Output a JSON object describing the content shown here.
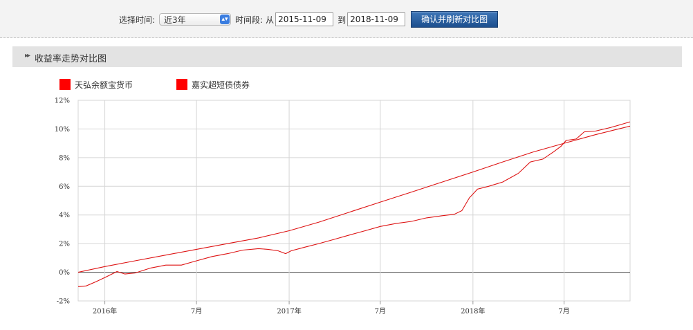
{
  "toolbar": {
    "select_time_label": "选择时间:",
    "period_value": "近3年",
    "range_label": "时间段:",
    "from_label": "从",
    "start_date": "2015-11-09",
    "to_label": "到",
    "end_date": "2018-11-09",
    "confirm_button": "确认并刷新对比图"
  },
  "section": {
    "title": "收益率走势对比图"
  },
  "colors": {
    "series1": "#ff0000",
    "series2": "#e00000",
    "line": "#dd1111",
    "grid": "#d5d5d5",
    "zero_line": "#555555"
  },
  "chart_data": {
    "type": "line",
    "legend": [
      "天弘余额宝货币",
      "嘉实超短债债券"
    ],
    "legend_position": "top-left",
    "grid": true,
    "ylim": [
      -2,
      12
    ],
    "yticks": [
      "-2%",
      "0%",
      "2%",
      "4%",
      "6%",
      "8%",
      "10%",
      "12%"
    ],
    "xlim": [
      "2015-11-09",
      "2018-11-09"
    ],
    "xticks": [
      {
        "date": "2016-01-01",
        "label": "2016年"
      },
      {
        "date": "2016-07-01",
        "label": "7月"
      },
      {
        "date": "2017-01-01",
        "label": "2017年"
      },
      {
        "date": "2017-07-01",
        "label": "7月"
      },
      {
        "date": "2018-01-01",
        "label": "2018年"
      },
      {
        "date": "2018-07-01",
        "label": "7月"
      }
    ],
    "series": [
      {
        "name": "天弘余额宝货币",
        "points": [
          [
            "2015-11-09",
            0.0
          ],
          [
            "2016-01-01",
            0.4
          ],
          [
            "2016-03-01",
            0.8
          ],
          [
            "2016-05-01",
            1.2
          ],
          [
            "2016-07-01",
            1.6
          ],
          [
            "2016-09-01",
            2.0
          ],
          [
            "2016-11-01",
            2.4
          ],
          [
            "2017-01-01",
            2.9
          ],
          [
            "2017-03-01",
            3.5
          ],
          [
            "2017-05-01",
            4.2
          ],
          [
            "2017-07-01",
            4.9
          ],
          [
            "2017-09-01",
            5.6
          ],
          [
            "2017-11-01",
            6.3
          ],
          [
            "2018-01-01",
            7.0
          ],
          [
            "2018-03-01",
            7.7
          ],
          [
            "2018-05-01",
            8.4
          ],
          [
            "2018-07-01",
            9.0
          ],
          [
            "2018-09-01",
            9.6
          ],
          [
            "2018-11-09",
            10.2
          ]
        ]
      },
      {
        "name": "嘉实超短债债券",
        "points": [
          [
            "2015-11-09",
            -1.0
          ],
          [
            "2015-11-25",
            -0.95
          ],
          [
            "2015-12-15",
            -0.65
          ],
          [
            "2016-01-05",
            -0.3
          ],
          [
            "2016-01-25",
            0.05
          ],
          [
            "2016-02-10",
            -0.12
          ],
          [
            "2016-03-01",
            -0.05
          ],
          [
            "2016-04-01",
            0.3
          ],
          [
            "2016-05-01",
            0.5
          ],
          [
            "2016-06-01",
            0.5
          ],
          [
            "2016-07-01",
            0.8
          ],
          [
            "2016-08-01",
            1.1
          ],
          [
            "2016-09-01",
            1.3
          ],
          [
            "2016-10-01",
            1.55
          ],
          [
            "2016-11-01",
            1.65
          ],
          [
            "2016-11-20",
            1.6
          ],
          [
            "2016-12-10",
            1.5
          ],
          [
            "2016-12-25",
            1.3
          ],
          [
            "2017-01-05",
            1.5
          ],
          [
            "2017-02-01",
            1.75
          ],
          [
            "2017-03-01",
            2.0
          ],
          [
            "2017-04-01",
            2.3
          ],
          [
            "2017-05-01",
            2.6
          ],
          [
            "2017-06-01",
            2.9
          ],
          [
            "2017-07-01",
            3.2
          ],
          [
            "2017-08-01",
            3.4
          ],
          [
            "2017-09-01",
            3.55
          ],
          [
            "2017-10-01",
            3.8
          ],
          [
            "2017-11-01",
            3.95
          ],
          [
            "2017-11-25",
            4.05
          ],
          [
            "2017-12-10",
            4.3
          ],
          [
            "2017-12-25",
            5.2
          ],
          [
            "2018-01-10",
            5.8
          ],
          [
            "2018-02-01",
            6.0
          ],
          [
            "2018-03-01",
            6.3
          ],
          [
            "2018-04-01",
            6.9
          ],
          [
            "2018-04-25",
            7.7
          ],
          [
            "2018-05-20",
            7.9
          ],
          [
            "2018-06-10",
            8.4
          ],
          [
            "2018-06-25",
            8.8
          ],
          [
            "2018-07-05",
            9.2
          ],
          [
            "2018-07-25",
            9.3
          ],
          [
            "2018-08-10",
            9.8
          ],
          [
            "2018-09-01",
            9.85
          ],
          [
            "2018-10-01",
            10.1
          ],
          [
            "2018-11-09",
            10.5
          ]
        ]
      }
    ]
  }
}
